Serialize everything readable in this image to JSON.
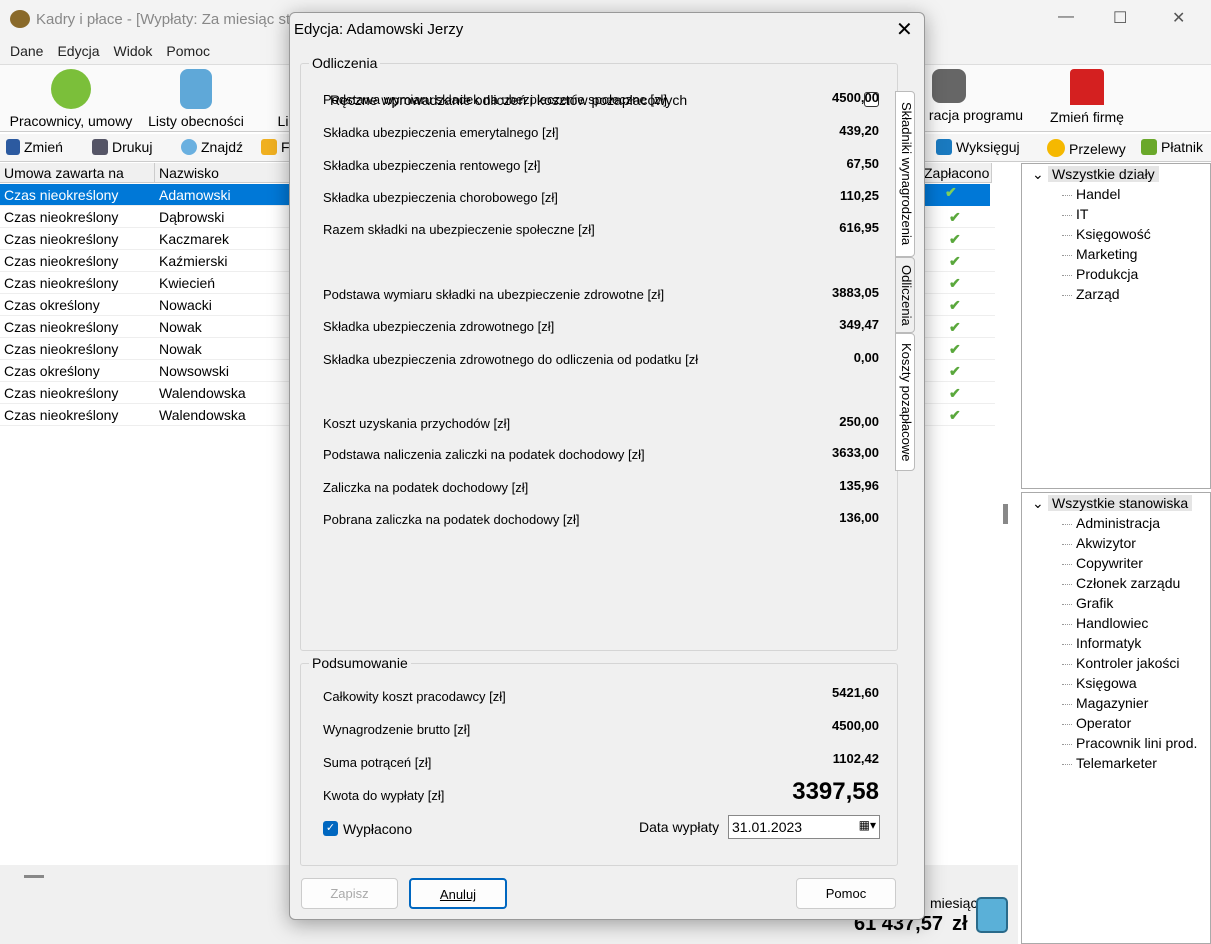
{
  "window": {
    "title": "Kadry i płace - [Wypłaty: Za miesiąc st",
    "menu": [
      "Dane",
      "Edycja",
      "Widok",
      "Pomoc"
    ]
  },
  "big_toolbar": [
    "Pracownicy, umowy",
    "Listy obecności",
    "Li",
    "racja programu",
    "Zmień firmę"
  ],
  "small_toolbar": [
    "Zmień",
    "Drukuj",
    "Znajdź",
    "F",
    "Wyksięguj",
    "Przelewy",
    "Płatnik"
  ],
  "table": {
    "headers": [
      "Umowa zawarta na",
      "Nazwisko",
      "Zapłacono"
    ],
    "rows": [
      [
        "Czas nieokreślony",
        "Adamowski"
      ],
      [
        "Czas nieokreślony",
        "Dąbrowski"
      ],
      [
        "Czas nieokreślony",
        "Kaczmarek"
      ],
      [
        "Czas nieokreślony",
        "Kaźmierski"
      ],
      [
        "Czas nieokreślony",
        "Kwiecień"
      ],
      [
        "Czas określony",
        "Nowacki"
      ],
      [
        "Czas nieokreślony",
        "Nowak"
      ],
      [
        "Czas nieokreślony",
        "Nowak"
      ],
      [
        "Czas określony",
        "Nowsowski"
      ],
      [
        "Czas nieokreślony",
        "Walendowska"
      ],
      [
        "Czas nieokreślony",
        "Walendowska"
      ]
    ]
  },
  "status": {
    "label": "miesiąc:",
    "total": "61 437,57",
    "currency": "zł"
  },
  "tree_departments": {
    "root": "Wszystkie działy",
    "items": [
      "Handel",
      "IT",
      "Księgowość",
      "Marketing",
      "Produkcja",
      "Zarząd"
    ]
  },
  "tree_positions": {
    "root": "Wszystkie stanowiska",
    "items": [
      "Administracja",
      "Akwizytor",
      "Copywriter",
      "Członek zarządu",
      "Grafik",
      "Handlowiec",
      "Informatyk",
      "Kontroler jakości",
      "Księgowa",
      "Magazynier",
      "Operator",
      "Pracownik lini prod.",
      "Telemarketer"
    ]
  },
  "dialog": {
    "title": "Edycja: Adamowski Jerzy",
    "group1": "Odliczenia",
    "manual_label": "Ręczne wprowadzanie odliczeń i kosztów pozapłacowych",
    "fields": [
      {
        "label": "Podstawa wymiaru składek na ubezpieczenie społeczne [zł]",
        "value": "4500,00"
      },
      {
        "label": "Składka ubezpieczenia emerytalnego [zł]",
        "value": "439,20"
      },
      {
        "label": "Składka ubezpieczenia rentowego [zł]",
        "value": "67,50"
      },
      {
        "label": "Składka ubezpieczenia chorobowego [zł]",
        "value": "110,25"
      },
      {
        "label": "Razem składki na ubezpieczenie społeczne [zł]",
        "value": "616,95"
      },
      {
        "label": "Podstawa wymiaru składki na ubezpieczenie zdrowotne [zł]",
        "value": "3883,05"
      },
      {
        "label": "Składka ubezpieczenia zdrowotnego [zł]",
        "value": "349,47"
      },
      {
        "label": "Składka ubezpieczenia zdrowotnego do odliczenia od podatku [zł",
        "value": "0,00"
      },
      {
        "label": "Koszt uzyskania przychodów [zł]",
        "value": "250,00"
      },
      {
        "label": "Podstawa naliczenia zaliczki na podatek dochodowy [zł]",
        "value": "3633,00"
      },
      {
        "label": "Zaliczka na podatek dochodowy [zł]",
        "value": "135,96"
      },
      {
        "label": "Pobrana zaliczka na podatek dochodowy [zł]",
        "value": "136,00"
      }
    ],
    "tabs": [
      "Składniki wynagrodzenia",
      "Odliczenia",
      "Koszty pozapłacowe"
    ],
    "group2": "Podsumowanie",
    "summary": [
      {
        "label": "Całkowity koszt pracodawcy [zł]",
        "value": "5421,60"
      },
      {
        "label": "Wynagrodzenie brutto [zł]",
        "value": "4500,00"
      },
      {
        "label": "Suma potrąceń [zł]",
        "value": "1102,42"
      },
      {
        "label": "Kwota do wypłaty [zł]",
        "value": "3397,58"
      }
    ],
    "paid_label": "Wypłacono",
    "date_label": "Data wypłaty",
    "date_value": "31.01.2023",
    "buttons": {
      "save": "Zapisz",
      "cancel": "Anuluj",
      "help": "Pomoc"
    }
  }
}
